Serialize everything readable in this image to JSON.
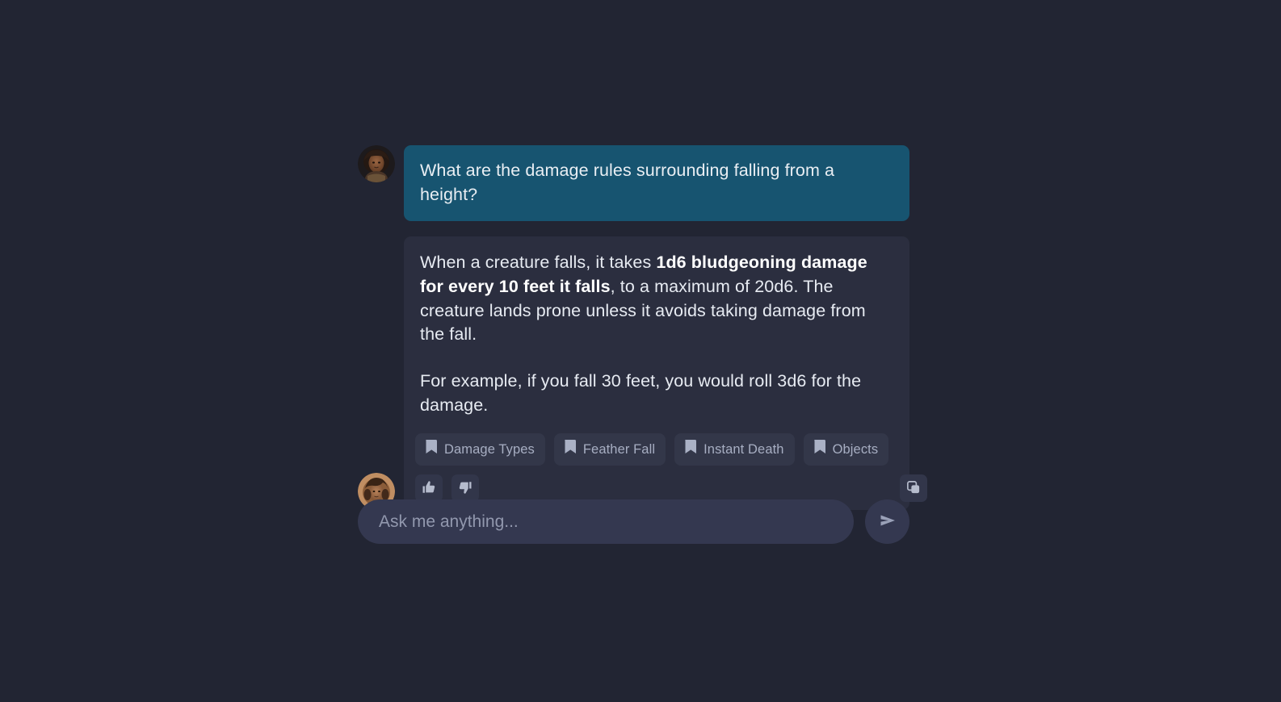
{
  "theme": {
    "page_bg": "#222533",
    "user_bubble_bg": "#175470",
    "assistant_bubble_bg": "#2b2e3f",
    "chip_bg": "#333749",
    "chip_text": "#a7aec2",
    "input_bg": "#343850",
    "body_text": "#e7ebf2"
  },
  "conversation": {
    "user_message": {
      "avatar_name": "user-avatar",
      "text": "What are the damage rules surrounding falling from a height?"
    },
    "assistant_message": {
      "avatar_name": "assistant-avatar",
      "paragraph_1": {
        "before_bold": "When a creature falls, it takes ",
        "bold": "1d6 bludgeoning damage for every 10 feet it falls",
        "after_bold": ", to a maximum of 20d6. The creature lands prone unless it avoids taking damage from the fall."
      },
      "paragraph_2": "For example, if you fall 30 feet, you would roll 3d6 for the damage.",
      "sources": [
        {
          "label": "Damage Types",
          "icon": "bookmark-icon"
        },
        {
          "label": "Feather Fall",
          "icon": "bookmark-icon"
        },
        {
          "label": "Instant Death",
          "icon": "bookmark-icon"
        },
        {
          "label": "Objects",
          "icon": "bookmark-icon"
        }
      ],
      "actions": {
        "thumbs_up": "thumbs-up-icon",
        "thumbs_down": "thumbs-down-icon",
        "copy": "copy-icon"
      }
    }
  },
  "composer": {
    "placeholder": "Ask me anything...",
    "value": "",
    "send_icon": "send-icon"
  }
}
